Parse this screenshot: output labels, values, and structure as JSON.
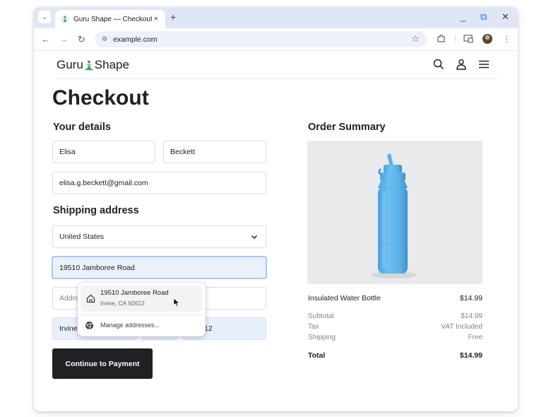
{
  "browser": {
    "tab_title": "Guru Shape — Checkout",
    "tab_close": "×",
    "new_tab": "+",
    "url": "example.com",
    "controls": {
      "minimize": "_",
      "restore": "⧉",
      "close": "✕"
    }
  },
  "site": {
    "logo_left": "Guru",
    "logo_right": "Shape"
  },
  "checkout": {
    "title": "Checkout",
    "your_details_heading": "Your details",
    "first_name_value": "Elisa",
    "last_name_value": "Beckett",
    "email_value": "elisa.g.beckett@gmail.com",
    "shipping_heading": "Shipping address",
    "country_value": "United States",
    "address_value": "19510 Jamboree Road",
    "address2_placeholder": "Addre",
    "city_value": "Irvine",
    "zip_value": "12",
    "continue_label": "Continue to Payment"
  },
  "autofill": {
    "suggestion_line1": "19510 Jamboree Road",
    "suggestion_line2": "Irvine, CA 92612",
    "manage_label": "Manage addresses..."
  },
  "summary": {
    "heading": "Order Summary",
    "item_name": "Insulated Water Bottle",
    "item_price": "$14.99",
    "subtotal_label": "Subtotal",
    "subtotal_value": "$14.99",
    "tax_label": "Tax",
    "tax_value": "VAT Included",
    "shipping_label": "Shipping",
    "shipping_value": "Free",
    "total_label": "Total",
    "total_value": "$14.99"
  },
  "colors": {
    "tabstrip": "#dfe7f6",
    "omnibox": "#eef2f8",
    "focus_ring": "#a8c7fa",
    "primary_button": "#202124",
    "bottle": "#5fb3ea",
    "logo_green": "#3aa856"
  }
}
